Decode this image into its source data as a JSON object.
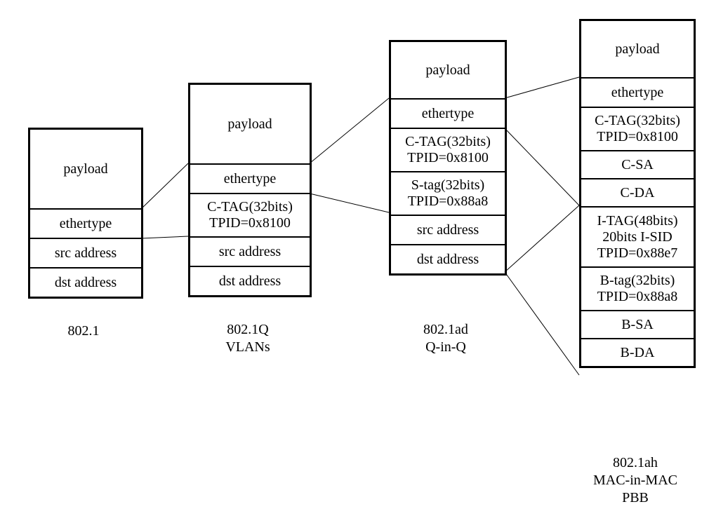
{
  "stacks": {
    "s1": {
      "label": "802.1",
      "cells": [
        "payload",
        "ethertype",
        "src address",
        "dst address"
      ]
    },
    "s2": {
      "label": "802.1Q\nVLANs",
      "cells": [
        "payload",
        "ethertype",
        "C-TAG(32bits)\nTPID=0x8100",
        "src address",
        "dst address"
      ]
    },
    "s3": {
      "label": "802.1ad\nQ-in-Q",
      "cells": [
        "payload",
        "ethertype",
        "C-TAG(32bits)\nTPID=0x8100",
        "S-tag(32bits)\nTPID=0x88a8",
        "src address",
        "dst address"
      ]
    },
    "s4": {
      "label": "802.1ah\nMAC-in-MAC\nPBB",
      "cells": [
        "payload",
        "ethertype",
        "C-TAG(32bits)\nTPID=0x8100",
        "C-SA",
        "C-DA",
        "I-TAG(48bits)\n20bits I-SID\nTPID=0x88e7",
        "B-tag(32bits)\nTPID=0x88a8",
        "B-SA",
        "B-DA"
      ]
    }
  }
}
